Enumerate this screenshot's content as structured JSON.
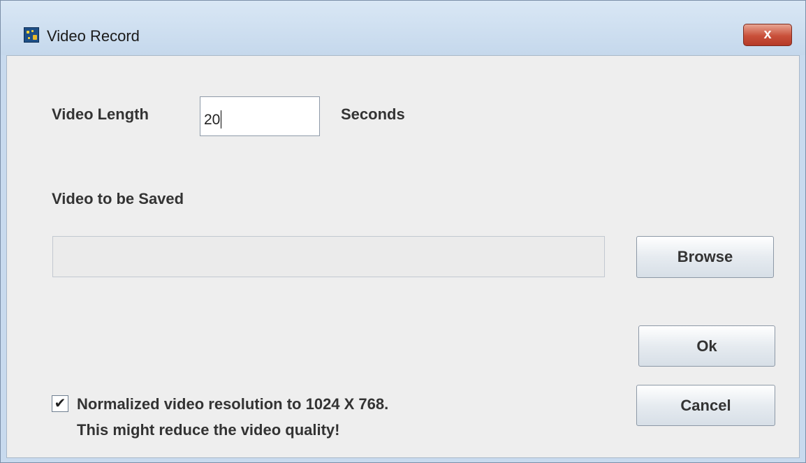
{
  "window": {
    "title": "Video Record",
    "close_symbol": "x"
  },
  "icons": {
    "app": "video-record-app-icon",
    "close": "close-icon",
    "check": "checkmark-icon"
  },
  "form": {
    "length_label": "Video Length",
    "length_value": "20",
    "length_unit": "Seconds",
    "save_label": "Video to be Saved",
    "save_path": ""
  },
  "buttons": {
    "browse": "Browse",
    "ok": "Ok",
    "cancel": "Cancel"
  },
  "normalize": {
    "checked": true,
    "check_mark": "✔",
    "line1": "Normalized video resolution to 1024 X 768.",
    "line2": "This might reduce the video quality!"
  },
  "colors": {
    "title_bar": "#c8daee",
    "content_bg": "#eeeeee",
    "close_button": "#c9503a"
  }
}
